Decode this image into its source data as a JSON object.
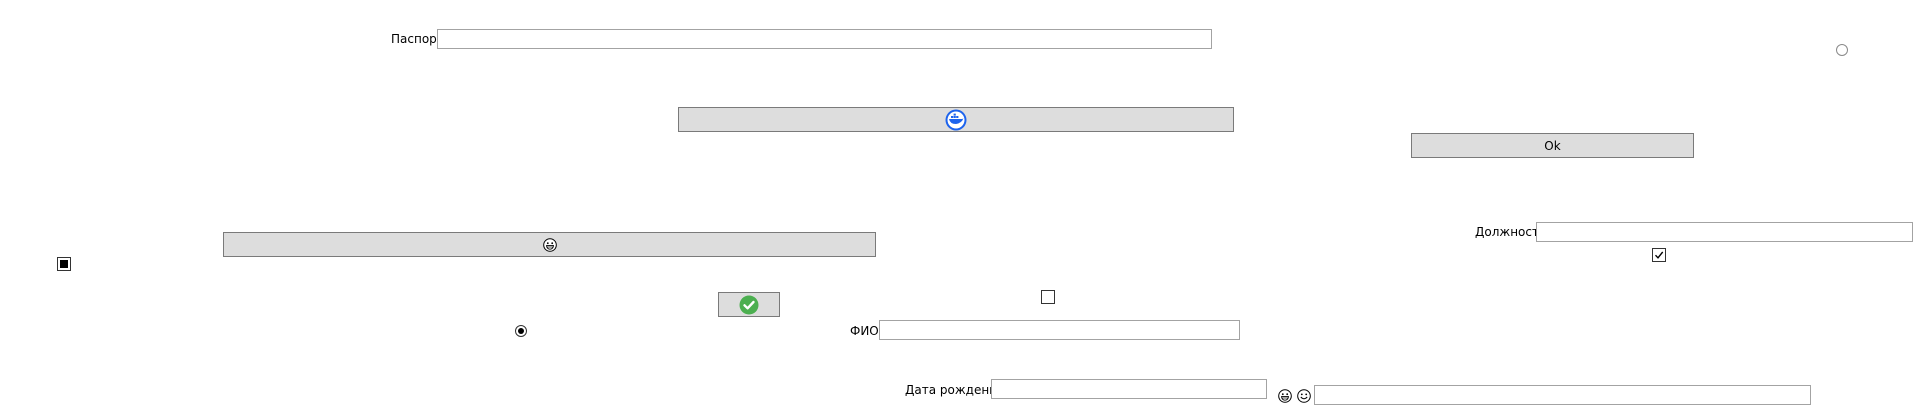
{
  "labels": {
    "passport": "Паспорт",
    "position": "Должность",
    "full_name": "ФИО",
    "birth_date": "Дата рождения"
  },
  "buttons": {
    "ok": "Ok"
  },
  "fields": {
    "passport": {
      "value": "",
      "placeholder": ""
    },
    "position": {
      "value": "",
      "placeholder": ""
    },
    "full_name": {
      "value": "",
      "placeholder": ""
    },
    "birth_date": {
      "value": "",
      "placeholder": ""
    },
    "extra": {
      "value": "",
      "placeholder": ""
    }
  },
  "controls": {
    "radio_top_right": {
      "checked": false
    },
    "radio_middle": {
      "checked": true
    },
    "checkbox_left": {
      "state": "indeterminate"
    },
    "checkbox_right": {
      "checked": true
    },
    "checkbox_center": {
      "checked": false
    }
  },
  "icons": {
    "button_1": "docker-whale-icon",
    "button_2": "grinning-face-icon",
    "button_3": "green-check-icon",
    "emoji_1": "grinning-face-icon",
    "emoji_2": "smiling-face-icon"
  },
  "colors": {
    "button_bg": "#dddddd",
    "docker_blue": "#1d63ed",
    "check_green": "#4caf50"
  }
}
